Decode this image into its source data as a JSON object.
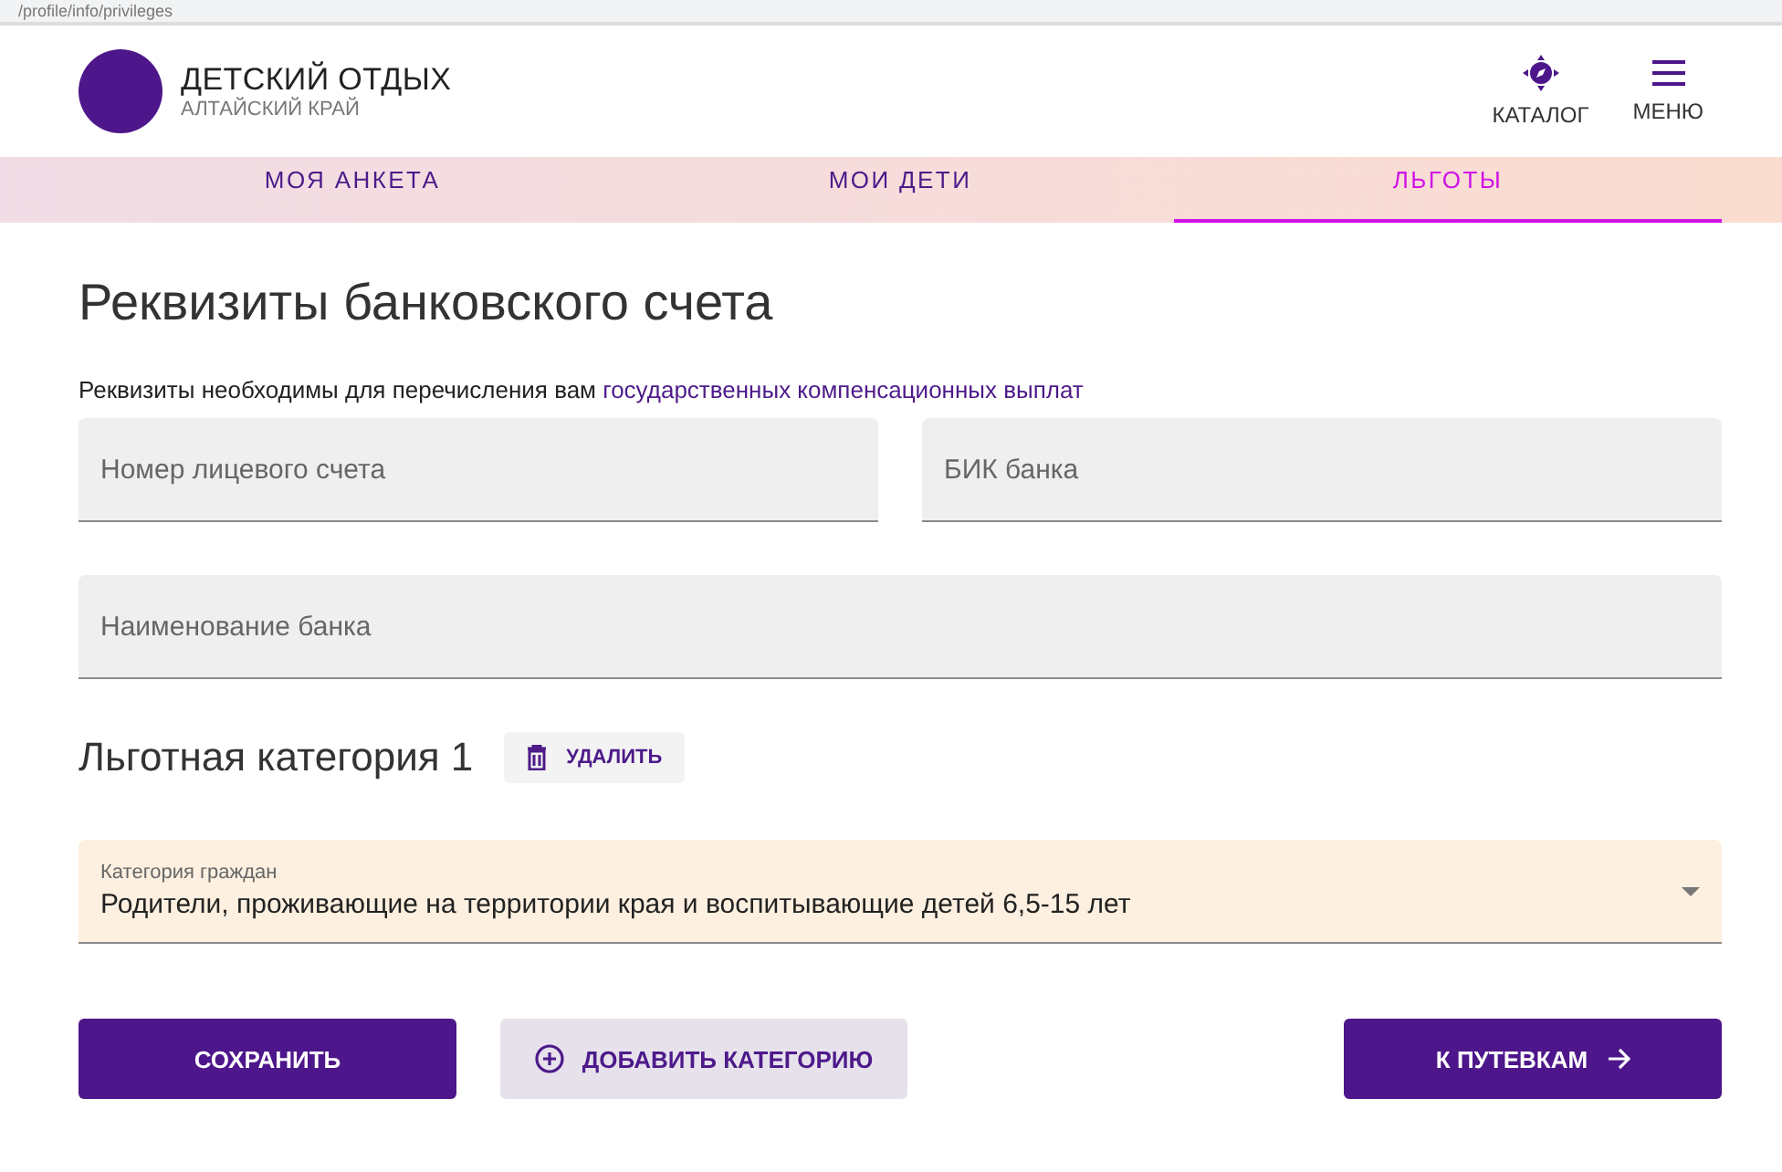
{
  "address_bar": {
    "url": "/profile/info/privileges"
  },
  "header": {
    "title": "ДЕТСКИЙ ОТДЫХ",
    "subtitle": "АЛТАЙСКИЙ КРАЙ",
    "actions": [
      {
        "kind": "catalog",
        "label": "КАТАЛОГ"
      },
      {
        "kind": "menu",
        "label": "МЕНЮ"
      }
    ]
  },
  "tabs": [
    {
      "label": "МОЯ АНКЕТА",
      "selected": false
    },
    {
      "label": "МОИ ДЕТИ",
      "selected": false
    },
    {
      "label": "ЛЬГОТЫ",
      "selected": true
    }
  ],
  "bank": {
    "title": "Реквизиты банковского счета",
    "note": "Реквизиты необходимы для перечисления вам",
    "note_link": "государственных компенсационных выплат",
    "fields": [
      {
        "placeholder": "Номер лицевого счета"
      },
      {
        "placeholder": "БИК банка"
      },
      {
        "placeholder": "Наименование банка"
      }
    ]
  },
  "category": {
    "title": "Льготная категория 1",
    "delete_button": "УДАЛИТЬ",
    "select": {
      "label": "Категория граждан",
      "value": "Родители, проживающие на территории края и воспитывающие детей 6,5-15 лет"
    }
  },
  "buttons": {
    "save": "СОХРАНИТЬ",
    "add": "ДОБАВИТЬ КАТЕГОРИЮ",
    "next": "К ПУТЕВКАМ"
  }
}
